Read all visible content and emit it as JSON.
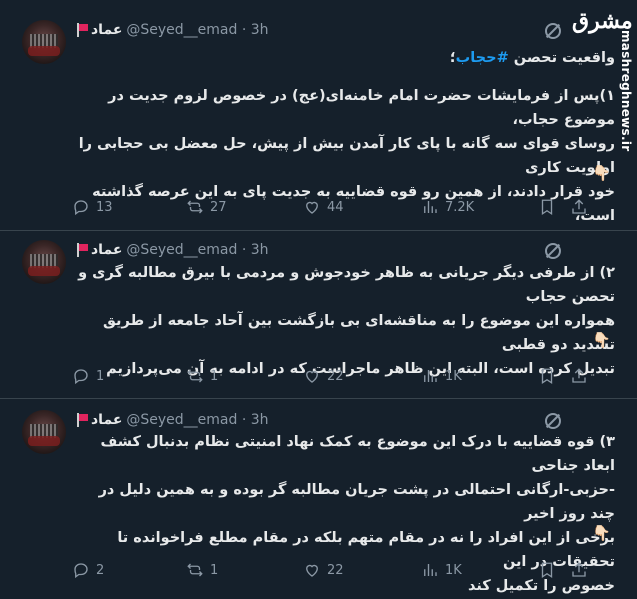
{
  "watermark": {
    "logo_text": "مشرق",
    "url": "mashreghnews.ir"
  },
  "tweets": [
    {
      "name": "عماد",
      "handle": "@Seyed__emad",
      "time": "3h",
      "title_line": "واقعیت تحصن ",
      "hashtag": "#حجاب",
      "title_suffix": "؛",
      "lines": [
        "۱)پس از فرمایشات حضرت امام خامنه‌ای(عج) در خصوص لزوم جدیت در موضوع حجاب،",
        "روسای قوای سه گانه با پای کار آمدن بیش از پیش، حل معضل بی حجابی را اولویت کاری",
        "خود قرار دادند، از همین رو قوه قضاییه به جدیت پای به این عرصه گذاشته است،"
      ],
      "hand": "👇🏻",
      "replies": "13",
      "retweets": "27",
      "likes": "44",
      "views": "7.2K"
    },
    {
      "name": "عماد",
      "handle": "@Seyed__emad",
      "time": "3h",
      "lines": [
        "۲) از طرفی دیگر جریانی به ظاهر خودجوش و مردمی با بیرق مطالبه گری و تحصن حجاب",
        "همواره این موضوع را به مناقشه‌ای بی بازگشت بین آحاد جامعه از طریق تشدید دو قطبی",
        "تبدیل کرده است، البته این ظاهر ماجراست که در ادامه به آن می‌پردازیم"
      ],
      "hand": "👇🏻",
      "replies": "1",
      "retweets": "1",
      "likes": "22",
      "views": "1K"
    },
    {
      "name": "عماد",
      "handle": "@Seyed__emad",
      "time": "3h",
      "lines": [
        "۳) قوه قضاییه با درک این موضوع به کمک نهاد امنیتی نظام بدنبال کشف ابعاد جناحی",
        "-حزبی-ارگانی احتمالی در پشت جریان مطالبه گر بوده و به همین دلیل در چند روز اخیر",
        "برخی از این افراد را نه در مقام متهم بلکه در مقام مطلع فراخوانده تا تحقیقات در این",
        "خصوص را تکمیل کند"
      ],
      "hand": "👇🏻",
      "replies": "2",
      "retweets": "1",
      "likes": "22",
      "views": "1K"
    }
  ]
}
